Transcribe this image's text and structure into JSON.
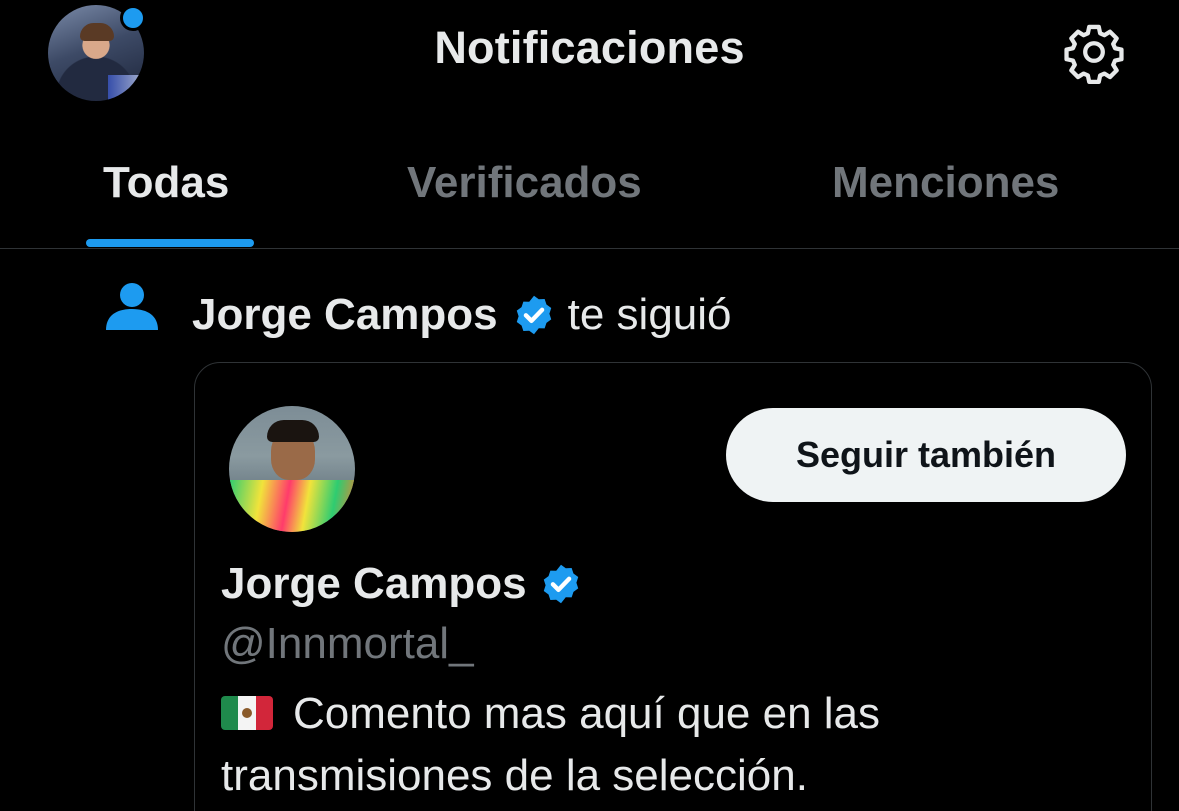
{
  "header": {
    "title": "Notificaciones",
    "has_unread": true
  },
  "tabs": [
    {
      "label": "Todas",
      "active": true
    },
    {
      "label": "Verificados",
      "active": false
    },
    {
      "label": "Menciones",
      "active": false
    }
  ],
  "notification": {
    "icon": "person-icon",
    "actor_name": "Jorge Campos",
    "verified": true,
    "action": "te siguió"
  },
  "card": {
    "name": "Jorge Campos",
    "handle": "@Innmortal_",
    "verified": true,
    "follow_button": "Seguir también",
    "bio_line1": "Comento mas aquí que en las",
    "bio_line2": "transmisiones de la selección."
  },
  "colors": {
    "accent": "#1d9bf0",
    "background": "#000000",
    "text_primary": "#e7e9ea",
    "text_secondary": "#71767b",
    "button_bg": "#eff3f4"
  }
}
